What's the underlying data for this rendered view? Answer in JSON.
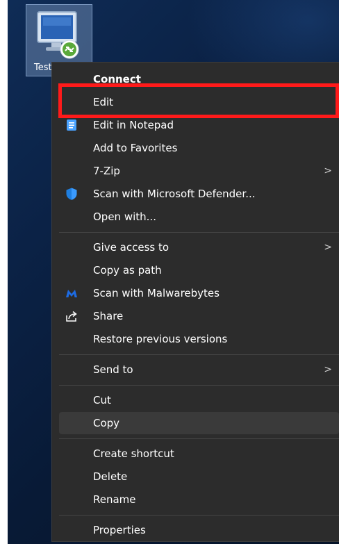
{
  "desktop_icon": {
    "label": "Test",
    "icon": "remote-desktop-connection-icon"
  },
  "menu": {
    "items": [
      {
        "label": "Connect",
        "bold": true
      },
      {
        "label": "Edit"
      },
      {
        "label": "Edit in Notepad",
        "icon": "notepad-icon"
      },
      {
        "label": "Add to Favorites"
      },
      {
        "label": "7-Zip",
        "submenu": true
      },
      {
        "label": "Scan with Microsoft Defender...",
        "icon": "defender-shield-icon"
      },
      {
        "label": "Open with..."
      },
      {
        "label": "Give access to",
        "submenu": true
      },
      {
        "label": "Copy as path"
      },
      {
        "label": "Scan with Malwarebytes",
        "icon": "malwarebytes-icon"
      },
      {
        "label": "Share",
        "icon": "share-icon"
      },
      {
        "label": "Restore previous versions"
      },
      {
        "label": "Send to",
        "submenu": true
      },
      {
        "label": "Cut"
      },
      {
        "label": "Copy",
        "hovered": true
      },
      {
        "label": "Create shortcut"
      },
      {
        "label": "Delete"
      },
      {
        "label": "Rename"
      },
      {
        "label": "Properties"
      }
    ],
    "submenu_glyph": ">"
  },
  "annotation": {
    "highlighted_item": "Edit",
    "color": "#ff1a1a"
  }
}
